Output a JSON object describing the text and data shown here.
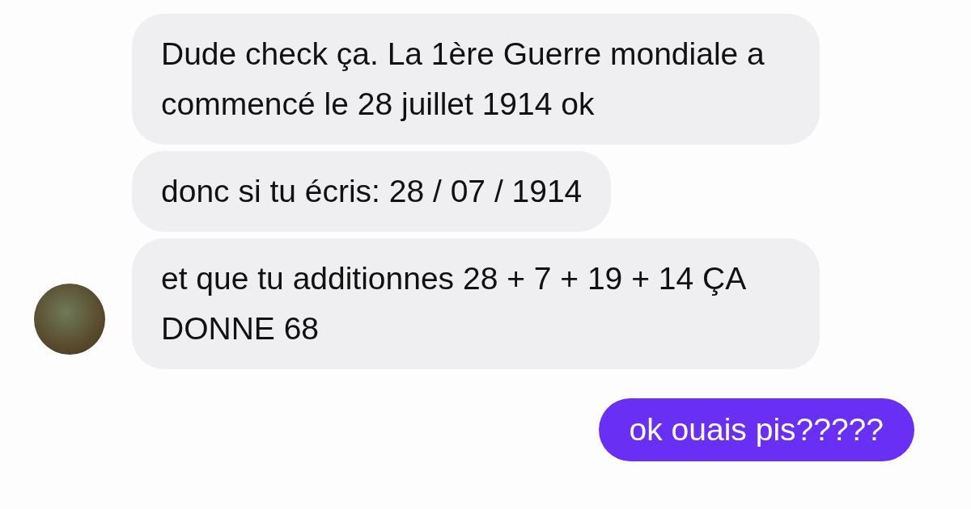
{
  "messages": [
    {
      "kind": "incoming",
      "text": "Dude check ça. La 1ère Guerre mondiale a commencé le 28 juillet 1914 ok"
    },
    {
      "kind": "incoming",
      "text": "donc si tu écris: 28 / 07 / 1914"
    },
    {
      "kind": "incoming",
      "text": "et que tu additionnes 28 + 7 + 19 + 14 ÇA DONNE 68"
    },
    {
      "kind": "outgoing",
      "text": "ok ouais pis?????"
    }
  ]
}
